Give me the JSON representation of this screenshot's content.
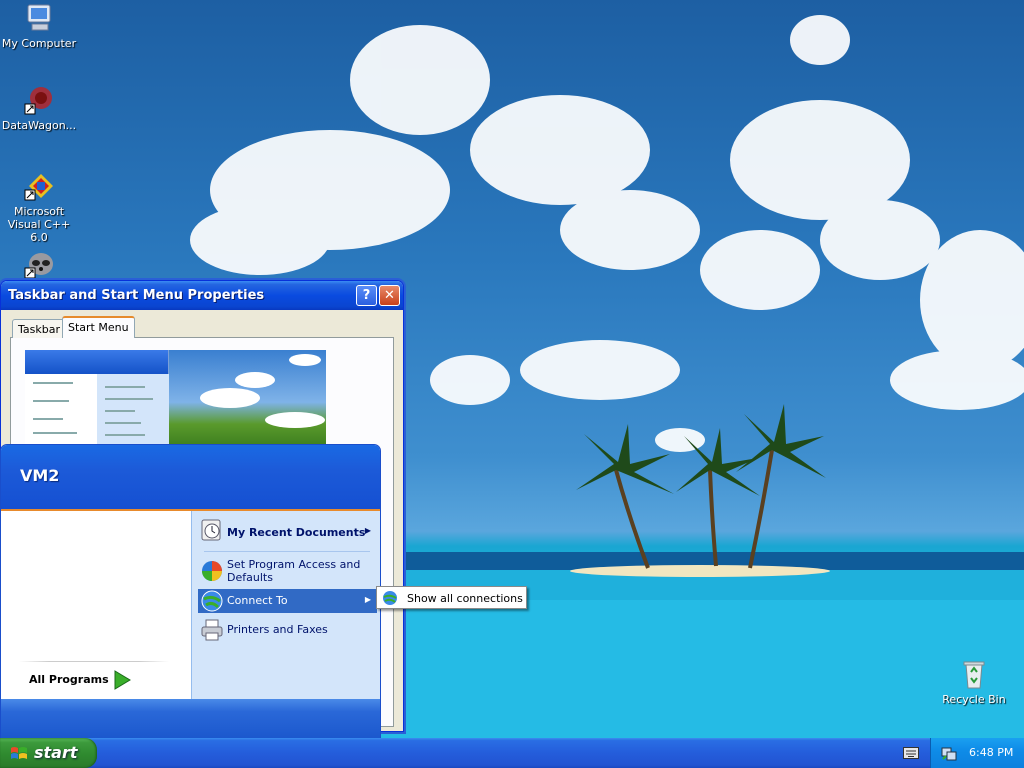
{
  "desktop": {
    "icons": [
      {
        "label": "My Computer",
        "icon": "my-computer-icon"
      },
      {
        "label": "DataWagon...",
        "icon": "datawagon-shortcut-icon"
      },
      {
        "label": "Microsoft Visual C++ 6.0",
        "icon": "visual-cpp-shortcut-icon"
      },
      {
        "label": "",
        "icon": "raccoon-shortcut-icon"
      }
    ],
    "recycle_bin": {
      "label": "Recycle Bin",
      "icon": "recycle-bin-icon"
    }
  },
  "properties_dialog": {
    "title": "Taskbar and Start Menu Properties",
    "help_label": "?",
    "close_label": "✕",
    "tabs": [
      {
        "label": "Taskbar",
        "selected": false
      },
      {
        "label": "Start Menu",
        "selected": true
      }
    ]
  },
  "start_menu": {
    "user_name": "VM2",
    "all_programs_label": "All Programs",
    "right_items": [
      {
        "label": "My Recent Documents",
        "icon": "recent-documents-icon",
        "has_submenu": true
      },
      {
        "label": "Set Program Access and Defaults",
        "icon": "program-access-icon",
        "has_submenu": false
      },
      {
        "label": "Connect To",
        "icon": "connect-to-icon",
        "has_submenu": true,
        "highlighted": true
      },
      {
        "label": "Printers and Faxes",
        "icon": "printers-faxes-icon",
        "has_submenu": false
      }
    ],
    "submenu_arrow": "▶"
  },
  "connect_submenu": {
    "items": [
      {
        "label": "Show all connections",
        "icon": "network-connections-icon"
      }
    ]
  },
  "taskbar": {
    "start_label": "start",
    "clock": "6:48 PM"
  },
  "colors": {
    "xp_blue": "#245ddb",
    "start_green": "#2f8a2f",
    "menu_highlight": "#316ac5",
    "tray_blue": "#0f8ce8"
  }
}
